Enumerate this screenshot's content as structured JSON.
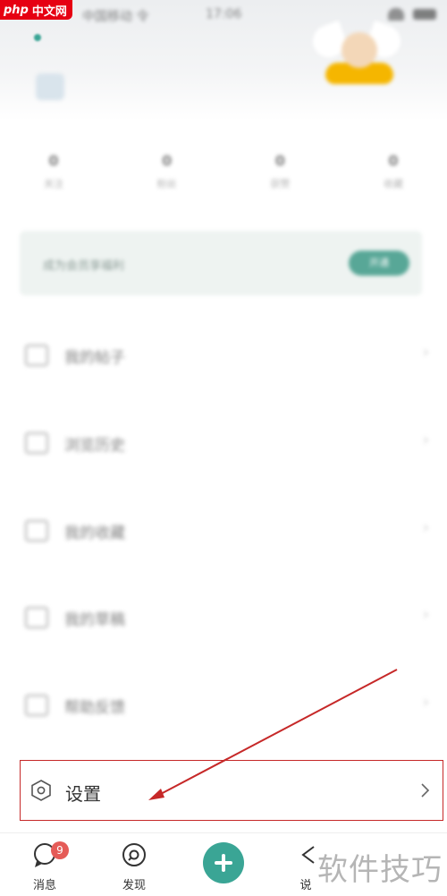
{
  "watermark": {
    "brand_prefix": "php",
    "brand_suffix": "中文网",
    "corner_text": "软件技巧"
  },
  "status_bar": {
    "carrier": "中国移动 令",
    "time": "17:06"
  },
  "stats": [
    {
      "value": "0",
      "label": "关注"
    },
    {
      "value": "0",
      "label": "粉丝"
    },
    {
      "value": "0",
      "label": "获赞"
    },
    {
      "value": "0",
      "label": "收藏"
    }
  ],
  "vip_card": {
    "text": "成为会员享福利",
    "button": "开通"
  },
  "menu": [
    {
      "label": "我的帖子",
      "icon": "post-icon"
    },
    {
      "label": "浏览历史",
      "icon": "history-icon"
    },
    {
      "label": "我的收藏",
      "icon": "star-icon"
    },
    {
      "label": "我的草稿",
      "icon": "draft-icon"
    },
    {
      "label": "帮助反馈",
      "icon": "help-icon"
    }
  ],
  "settings": {
    "label": "设置",
    "icon": "gear-icon"
  },
  "tabbar": {
    "messages": {
      "label": "消息",
      "badge": "9"
    },
    "discover": {
      "label": "发现"
    },
    "add": {
      "icon": "plus-icon"
    },
    "more": {
      "label": "说"
    }
  },
  "colors": {
    "accent": "#3aa595",
    "annotation": "#c62828",
    "badge": "#e55b57"
  }
}
